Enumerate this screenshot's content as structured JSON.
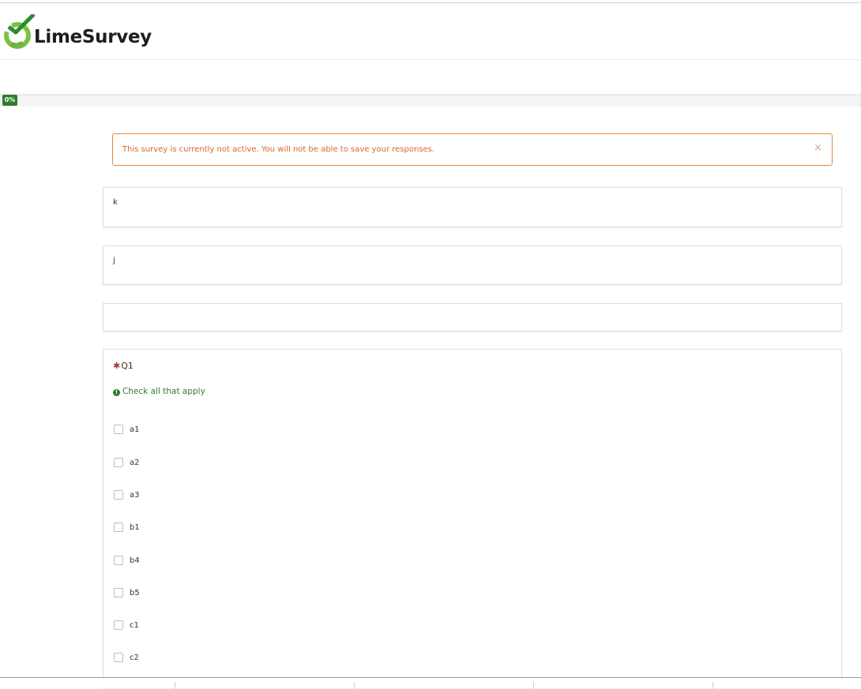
{
  "brand": {
    "name": "LimeSurvey",
    "logo_icon": "limesurvey-logo-icon",
    "accent_green": "#2d7d2d"
  },
  "progress": {
    "label": "0%",
    "value": 0
  },
  "alert": {
    "message": "This survey is currently not active. You will not be able to save your responses.",
    "close_label": "×"
  },
  "text_questions": [
    {
      "text": "k"
    },
    {
      "text": "j"
    },
    {
      "text": ""
    }
  ],
  "question": {
    "mandatory_mark": "✱",
    "title": "Q1",
    "tip": "Check all that apply",
    "tip_icon": "exclamation-circle-icon",
    "answers": [
      {
        "label": "a1",
        "checked": false
      },
      {
        "label": "a2",
        "checked": false
      },
      {
        "label": "a3",
        "checked": false
      },
      {
        "label": "b1",
        "checked": false
      },
      {
        "label": "b4",
        "checked": false
      },
      {
        "label": "b5",
        "checked": false
      },
      {
        "label": "c1",
        "checked": false
      },
      {
        "label": "c2",
        "checked": false
      }
    ]
  }
}
